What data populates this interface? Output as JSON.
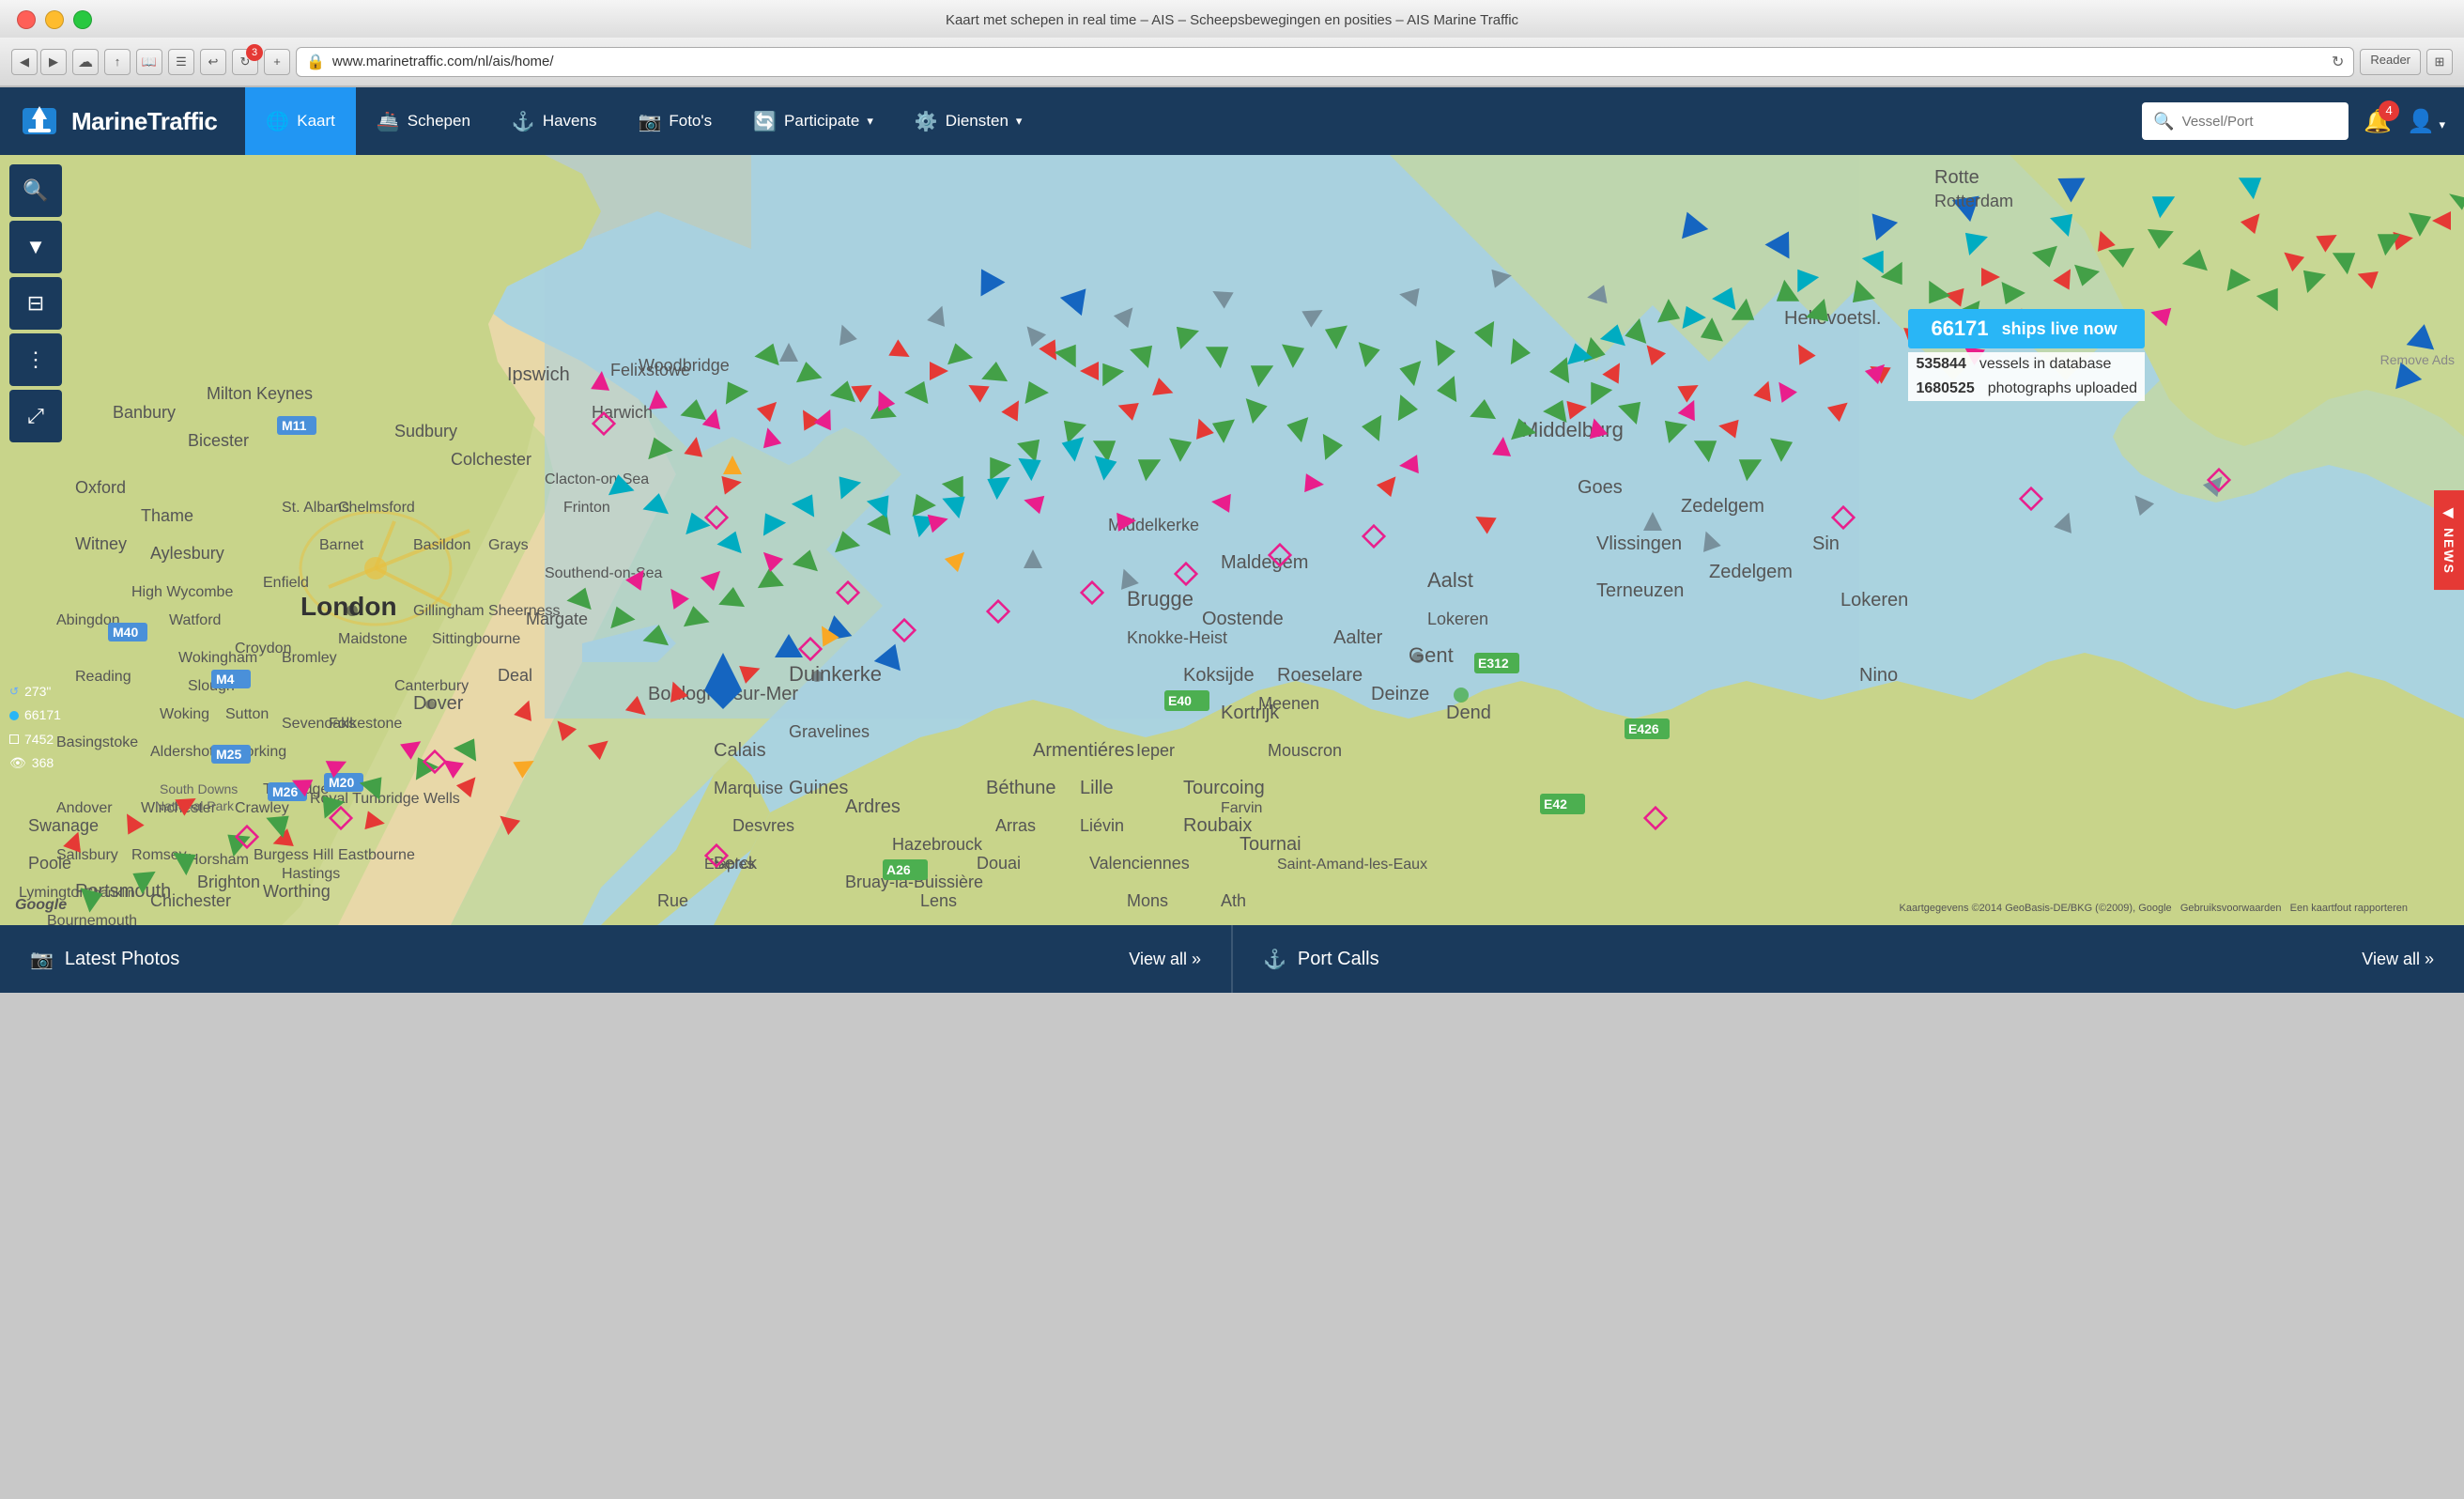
{
  "window": {
    "title": "Kaart met schepen in real time – AIS – Scheepsbewegingen en posities – AIS Marine Traffic"
  },
  "browser": {
    "url": "www.marinetraffic.com/nl/ais/home/",
    "reader_label": "Reader",
    "nav_badge": "3"
  },
  "navbar": {
    "brand": "MarineTraffic",
    "items": [
      {
        "id": "kaart",
        "label": "Kaart",
        "icon": "🌐",
        "active": true
      },
      {
        "id": "schepen",
        "label": "Schepen",
        "icon": "🚢",
        "active": false
      },
      {
        "id": "havens",
        "label": "Havens",
        "icon": "⚓",
        "active": false
      },
      {
        "id": "fotos",
        "label": "Foto's",
        "icon": "📷",
        "active": false
      },
      {
        "id": "participate",
        "label": "Participate",
        "icon": "🔄",
        "active": false,
        "dropdown": true
      },
      {
        "id": "diensten",
        "label": "Diensten",
        "icon": "⚙️",
        "active": false,
        "dropdown": true
      }
    ],
    "search_placeholder": "Vessel/Port",
    "notification_count": "4"
  },
  "stats": {
    "live_count": "66171",
    "live_label": "ships live now",
    "vessels_count": "535844",
    "vessels_label": "vessels in database",
    "photos_count": "1680525",
    "photos_label": "photographs uploaded"
  },
  "map": {
    "zoom_level": "273\"",
    "stat1_value": "66171",
    "stat2_value": "7452",
    "stat3_value": "368",
    "google_label": "Google",
    "attribution": "Kaartgegevens ©2014 GeoBasis-DE/BKG (©2009), Google",
    "terms": "Gebruiksvoorwaarden",
    "report": "Een kaartfout rapporteren",
    "remove_ads": "Remove Ads",
    "news_label": "NEWS"
  },
  "toolbar": {
    "buttons": [
      {
        "id": "search",
        "icon": "🔍"
      },
      {
        "id": "filter",
        "icon": "▼"
      },
      {
        "id": "layers",
        "icon": "⊟"
      },
      {
        "id": "nodes",
        "icon": "⋮"
      },
      {
        "id": "fullscreen",
        "icon": "⤢"
      }
    ]
  },
  "bottom_bar": {
    "photos_icon": "📷",
    "photos_label": "Latest Photos",
    "photos_view_all": "View all »",
    "port_icon": "⚓",
    "port_label": "Port Calls",
    "port_view_all": "View all »"
  }
}
